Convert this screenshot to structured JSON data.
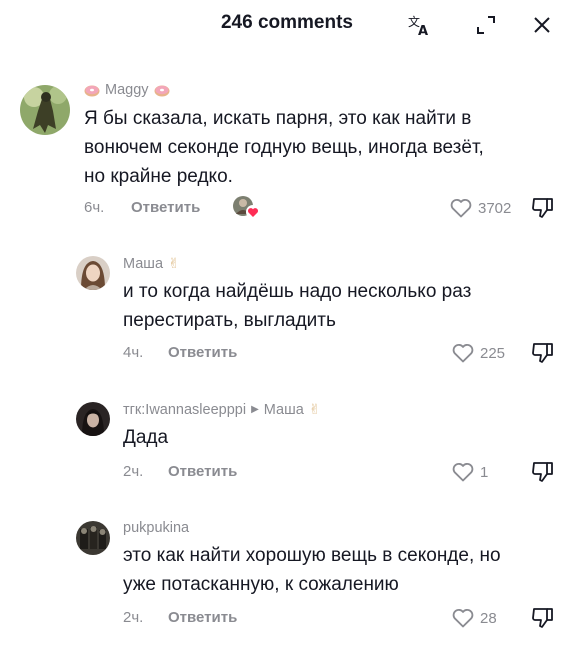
{
  "header": {
    "title": "246 comments",
    "icons": [
      "translate-icon",
      "expand-icon",
      "close-icon"
    ]
  },
  "comments": [
    {
      "username": "Maggy",
      "text_lines": [
        "Я бы сказала, искать парня, это как найти в",
        "вонючем секонде годную вещь, иногда везёт,",
        "но крайне редко."
      ],
      "time": "6ч.",
      "reply_label": "Ответить",
      "likes": "3702",
      "liked_by_creator": true
    },
    {
      "username": "Маша",
      "text_lines": [
        "и то когда найдёшь надо несколько раз",
        "перестирать, выгладить"
      ],
      "time": "4ч.",
      "reply_label": "Ответить",
      "likes": "225"
    },
    {
      "username": "тгк:Iwannasleepppi",
      "reply_to": "Маша",
      "text_lines": [
        "Дада"
      ],
      "time": "2ч.",
      "reply_label": "Ответить",
      "likes": "1"
    },
    {
      "username": "pukpukina",
      "text_lines": [
        "это как найти хорошую вещь в секонде, но",
        "уже потасканную, к сожалению"
      ],
      "time": "2ч.",
      "reply_label": "Ответить",
      "likes": "28"
    }
  ]
}
